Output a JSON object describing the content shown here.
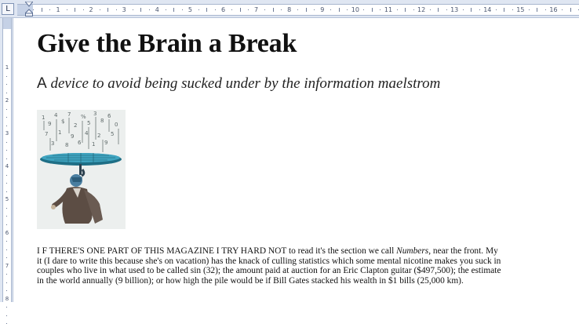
{
  "ruler": {
    "tab_selector": "L",
    "numbers": [
      "1",
      "2",
      "3",
      "4",
      "5",
      "6",
      "7",
      "8",
      "9",
      "10",
      "11",
      "12",
      "13",
      "14",
      "15",
      "16"
    ],
    "vertical_numbers": [
      "1",
      "2",
      "3",
      "4",
      "5",
      "6",
      "7",
      "8"
    ]
  },
  "document": {
    "title": "Give the Brain a Break",
    "subtitle_lead": "A",
    "subtitle_rest": " device to avoid being sucked under by the information maelstrom",
    "body_lines": [
      {
        "before": "I F THERE'S ONE PART OF THIS MAGAZINE I TRY HARD NOT to read it's the section we call ",
        "italic": "Numbers",
        "after": ", near the front. My"
      },
      {
        "before": "it (I dare to write this because she's on vacation) has the knack of culling statistics which some mental nicotine makes you suck in",
        "italic": "",
        "after": ""
      },
      {
        "before": "couples who live in what used to be called sin (32); the amount paid at auction for an Eric Clapton guitar ($497,500); the estimate",
        "italic": "",
        "after": ""
      },
      {
        "before": "in the world annually (9 billion); or how high the pile would be if Bill Gates stacked his wealth in $1 bills (25,000 km).",
        "italic": "",
        "after": ""
      }
    ]
  }
}
